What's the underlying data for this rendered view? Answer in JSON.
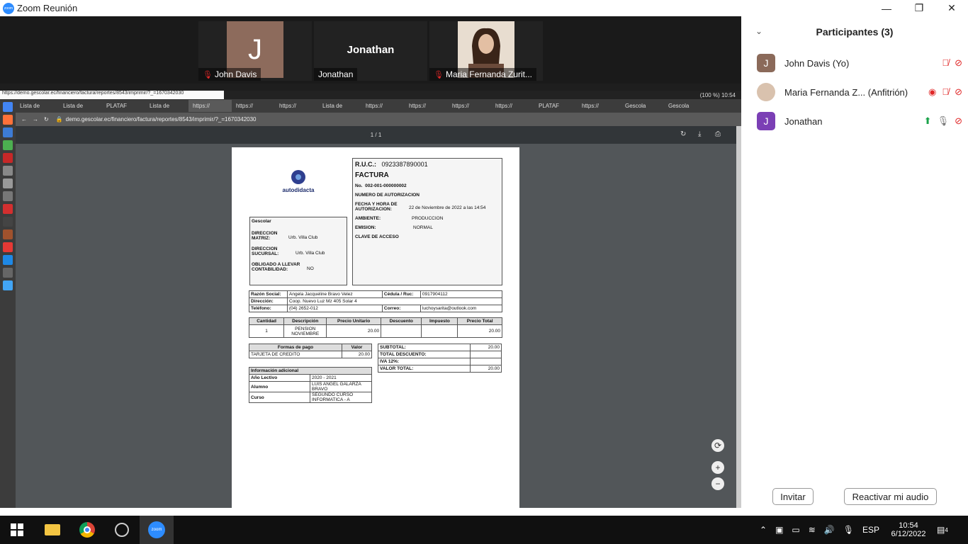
{
  "window": {
    "title": "Zoom Reunión",
    "controls": [
      "—",
      "❐",
      "✕"
    ]
  },
  "videos": [
    {
      "name": "John Davis",
      "initial": "J",
      "muted": true
    },
    {
      "name": "Jonathan",
      "center_label": "Jonathan",
      "muted": false
    },
    {
      "name": "Maria Fernanda Zurit...",
      "muted": true
    }
  ],
  "shared_screen": {
    "status_url": "https://demo.gescolar.ec/financiero/factura/reportes/8543/imprimir/?_=1670342030",
    "sys_tray": "(100 %)  10:54",
    "tabs": [
      "Lista de",
      "Lista de",
      "PLATAF",
      "Lista de",
      "https://",
      "https://",
      "https://",
      "Lista de",
      "https://",
      "https://",
      "https://",
      "https://",
      "PLATAF",
      "https://",
      "Gescola",
      "Gescola"
    ],
    "address": "demo.gescolar.ec/financiero/factura/reportes/8543/imprimir/?_=1670342030",
    "pdf_page": "1 / 1"
  },
  "invoice": {
    "logo_text": "autodidacta",
    "ruc_label": "R.U.C.:",
    "ruc": "0923387890001",
    "doc_title": "FACTURA",
    "no_label": "No.",
    "no": "002-001-000000002",
    "auth_label": "NUMERO DE AUTORIZACION",
    "fecha_label": "FECHA Y HORA DE AUTORIZACION:",
    "fecha": "22 de Noviembre de 2022 a las 14:54",
    "ambiente_label": "AMBIENTE:",
    "ambiente": "PRODUCCION",
    "emision_label": "EMISION:",
    "emision": "NORMAL",
    "clave_label": "CLAVE DE ACCESO",
    "company": "Gescolar",
    "matriz_label": "DIRECCION MATRIZ:",
    "matriz": "Urb. Villa Club",
    "sucursal_label": "DIRECCION SUCURSAL:",
    "sucursal": "Urb. Villa Club",
    "obligado_label": "OBLIGADO A LLEVAR CONTABILIDAD:",
    "obligado": "NO",
    "razon_label": "Razón Social:",
    "razon": "Angela Jacqueline Bravo Velez",
    "cedula_label": "Cédula / Ruc:",
    "cedula": "0917904112",
    "direccion_label": "Dirección:",
    "direccion": "Coop. Nuevo Luz Mz 405 Solar 4",
    "telefono_label": "Teléfono:",
    "telefono": "(04) 2652-012",
    "correo_label": "Correo:",
    "correo": "luchoysarita@outlook.com",
    "items_headers": [
      "Cantidad",
      "Descripción",
      "Precio Unitario",
      "Descuento",
      "Impuesto",
      "Precio Total"
    ],
    "items": [
      [
        "1",
        "PENSION NOVIEMBRE",
        "20.00",
        "",
        "",
        "20.00"
      ]
    ],
    "pago_headers": [
      "Formas de pago",
      "Valor"
    ],
    "pago": [
      [
        "TARJETA DE CREDITO",
        "20.00"
      ]
    ],
    "totals": [
      [
        "SUBTOTAL:",
        "20.00"
      ],
      [
        "TOTAL DESCUENTO:",
        ""
      ],
      [
        "IVA 12%:",
        ""
      ],
      [
        "VALOR TOTAL:",
        "20.00"
      ]
    ],
    "info_title": "Información adicional",
    "info": [
      [
        "Año Lectivo",
        "2020 - 2021"
      ],
      [
        "Alumno",
        "LUIS ANGEL GALARZA BRAVO"
      ],
      [
        "Curso",
        "SEGUNDO CURSO INFORMATICA - A"
      ]
    ]
  },
  "participants": {
    "title": "Participantes (3)",
    "list": [
      {
        "name": "John Davis (Yo)",
        "initial": "J",
        "color": "#8b6a5a"
      },
      {
        "name": "Maria Fernanda Z... (Anfitrión)",
        "initial": "",
        "color": "#cfb49f"
      },
      {
        "name": "Jonathan",
        "initial": "J",
        "color": "#7b3fb5"
      }
    ],
    "invite_label": "Invitar",
    "audio_label": "Reactivar mi audio"
  },
  "taskbar": {
    "lang": "ESP",
    "time": "10:54",
    "date": "6/12/2022",
    "notif_count": "4"
  }
}
